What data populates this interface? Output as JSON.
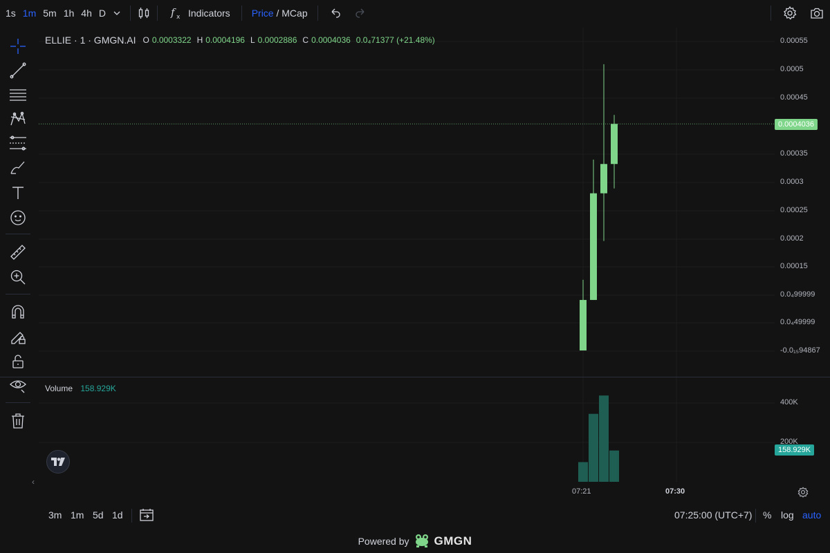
{
  "toolbar": {
    "timeframes": [
      "1s",
      "1m",
      "5m",
      "1h",
      "4h",
      "D"
    ],
    "active_timeframe": "1m",
    "indicators_label": "Indicators",
    "price_label": "Price",
    "slash": "/",
    "mcap_label": "MCap"
  },
  "legend": {
    "symbol": "ELLIE · 1 · GMGN.AI",
    "o_key": "O",
    "o_val": "0.0003322",
    "h_key": "H",
    "h_val": "0.0004196",
    "l_key": "L",
    "l_val": "0.0002886",
    "c_key": "C",
    "c_val": "0.0004036",
    "change": "0.0₄71377 (+21.48%)"
  },
  "price_axis": {
    "ticks": [
      "0.00055",
      "0.0005",
      "0.00045",
      "0.00035",
      "0.0003",
      "0.00025",
      "0.0002",
      "0.00015",
      "0.0₄99999",
      "0.0₄49999",
      "-0.0₁₅94867"
    ],
    "last_price": "0.0004036",
    "last_price_color": "#7fd68a"
  },
  "volume": {
    "label": "Volume",
    "value": "158.929K",
    "axis_ticks": [
      "400K",
      "200K"
    ],
    "tag_color": "#26a69a"
  },
  "time_axis": {
    "ticks": [
      "07:21",
      "07:30"
    ]
  },
  "chart_data": {
    "type": "candlestick",
    "candles": [
      {
        "open": 0.0,
        "high": 0.000126,
        "low": 0.0,
        "close": 9e-05
      },
      {
        "open": 9e-05,
        "high": 0.00034,
        "low": 9e-05,
        "close": 0.00028
      },
      {
        "open": 0.00028,
        "high": 0.00051,
        "low": 0.000195,
        "close": 0.0003322
      },
      {
        "open": 0.0003322,
        "high": 0.0004196,
        "low": 0.0002886,
        "close": 0.0004036
      }
    ],
    "volumes": [
      100000,
      345000,
      438000,
      158929
    ],
    "up_color": "#7fd68a",
    "volume_color": "#1f5e52"
  },
  "bottom": {
    "ranges": [
      "3m",
      "1m",
      "5d",
      "1d"
    ],
    "clock": "07:25:00 (UTC+7)",
    "percent": "%",
    "log": "log",
    "auto": "auto"
  },
  "footer": {
    "powered_by": "Powered by",
    "brand": "GMGN"
  }
}
